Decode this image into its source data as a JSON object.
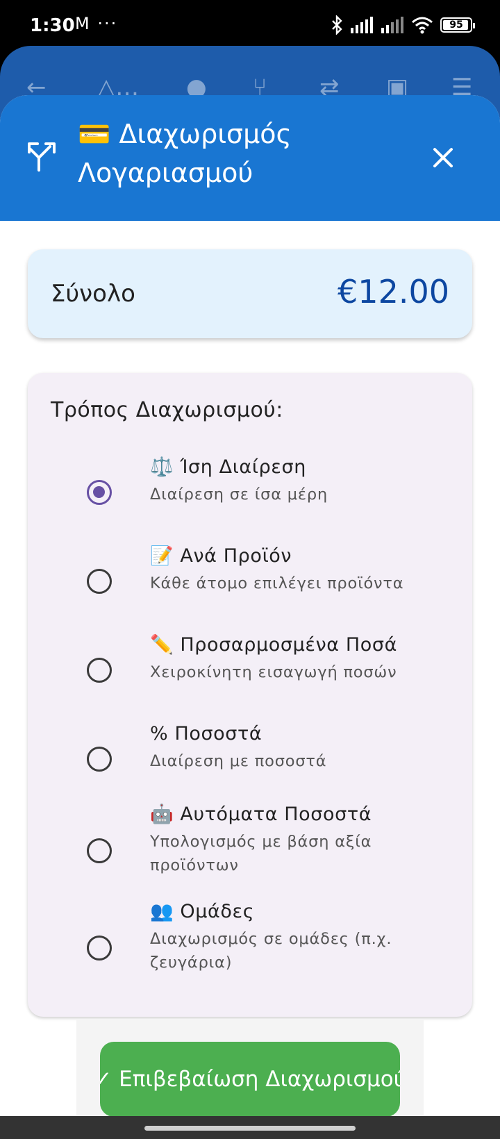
{
  "status_bar": {
    "time": "1:30",
    "left_icons": "M ···",
    "battery": "95",
    "battery_level": 0.95
  },
  "sheet": {
    "title": "💳 Διαχωρισμός Λογαριασμού",
    "header_icon": "call-split-icon",
    "close_icon": "close-icon"
  },
  "total": {
    "label": "Σύνολο",
    "amount": "€12.00"
  },
  "split_method": {
    "title": "Τρόπος Διαχωρισμού:",
    "options": [
      {
        "label": "⚖️ Ίση Διαίρεση",
        "sub": "Διαίρεση σε ίσα μέρη",
        "selected": true
      },
      {
        "label": "📝 Ανά Προϊόν",
        "sub": "Κάθε άτομο επιλέγει προϊόντα",
        "selected": false
      },
      {
        "label": "✏️ Προσαρμοσμένα Ποσά",
        "sub": "Χειροκίνητη εισαγωγή ποσών",
        "selected": false
      },
      {
        "label": "% Ποσοστά",
        "sub": "Διαίρεση με ποσοστά",
        "selected": false
      },
      {
        "label": "🤖 Αυτόματα Ποσοστά",
        "sub": "Υπολογισμός με βάση αξία προϊόντων",
        "selected": false
      },
      {
        "label": "👥 Ομάδες",
        "sub": "Διαχωρισμός σε ομάδες (π.χ. ζευγάρια)",
        "selected": false
      }
    ]
  },
  "confirm_button": "✓ Επιβεβαίωση Διαχωρισμού",
  "colors": {
    "header": "#1976d2",
    "total_card": "#e3f2fd",
    "amount": "#0d47a1",
    "radio_selected": "#6750a4",
    "confirm": "#4caf50"
  }
}
